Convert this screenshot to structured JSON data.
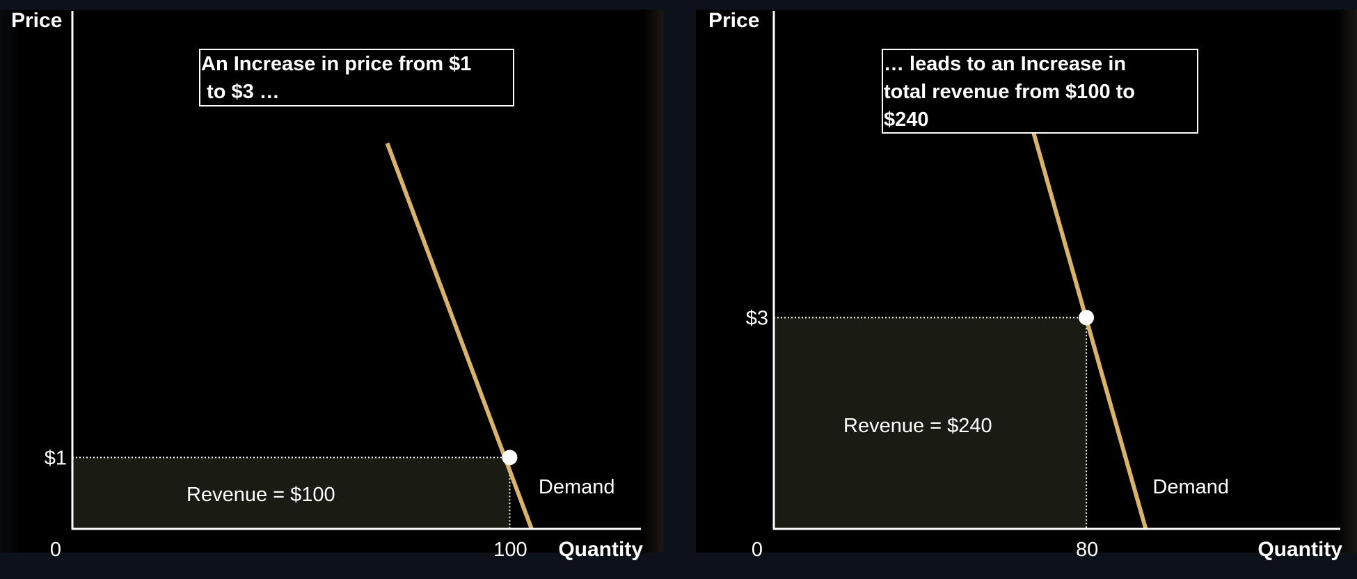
{
  "colors": {
    "background": "#000000",
    "demand_line": "#d9b36b",
    "revenue_fill": "#1a1b13",
    "axis": "#ffffff",
    "point": "#ffffff"
  },
  "chart_data": [
    {
      "type": "line",
      "title": "",
      "ylabel": "Price",
      "xlabel": "Quantity",
      "origin_label": "0",
      "price_label": "$1",
      "quantity_label": "100",
      "price": 1,
      "quantity": 100,
      "curve_label": "Demand",
      "revenue_label": "Revenue =  $100",
      "annotation": "An Increase in price from $1\n to $3 …",
      "series": [
        {
          "name": "Demand",
          "x": [
            72,
            105
          ],
          "y": [
            5.4,
            0
          ]
        }
      ],
      "point": {
        "x": 100,
        "y": 1
      },
      "xlim": [
        0,
        130
      ],
      "ylim": [
        0,
        7.25
      ]
    },
    {
      "type": "line",
      "title": "",
      "ylabel": "Price",
      "xlabel": "Quantity",
      "origin_label": "0",
      "price_label": "$3",
      "quantity_label": "80",
      "price": 3,
      "quantity": 80,
      "curve_label": "Demand",
      "revenue_label": "Revenue = $240",
      "annotation": "… leads to an Increase in\ntotal revenue from $100 to\n$240",
      "series": [
        {
          "name": "Demand",
          "x": [
            63.8,
            95.2
          ],
          "y": [
            6.15,
            0
          ]
        }
      ],
      "point": {
        "x": 80,
        "y": 3
      },
      "xlim": [
        0,
        145
      ],
      "ylim": [
        0,
        7.35
      ]
    }
  ]
}
